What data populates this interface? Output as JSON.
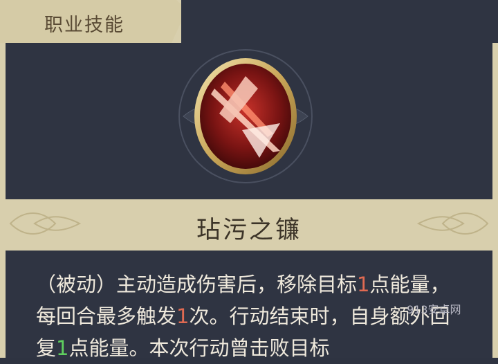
{
  "tab": {
    "title": "职业技能"
  },
  "skill": {
    "icon": "scythe-skill-icon",
    "name": "玷污之镰",
    "description": {
      "p1": "（被动）主动造成伤害后，移除目标",
      "n1": "1",
      "p2": "点能量，每回合最多触发",
      "n2": "1",
      "p3": "次。行动结束时，自身额外回复",
      "n3": "1",
      "p4": "点能量。本次行动曾击败目标"
    }
  },
  "watermark": "913安卓网",
  "colors": {
    "panel": "#2f3442",
    "gold_band": "#d8cfad",
    "highlight_red": "#e06a52",
    "highlight_green": "#5fcf5f"
  }
}
